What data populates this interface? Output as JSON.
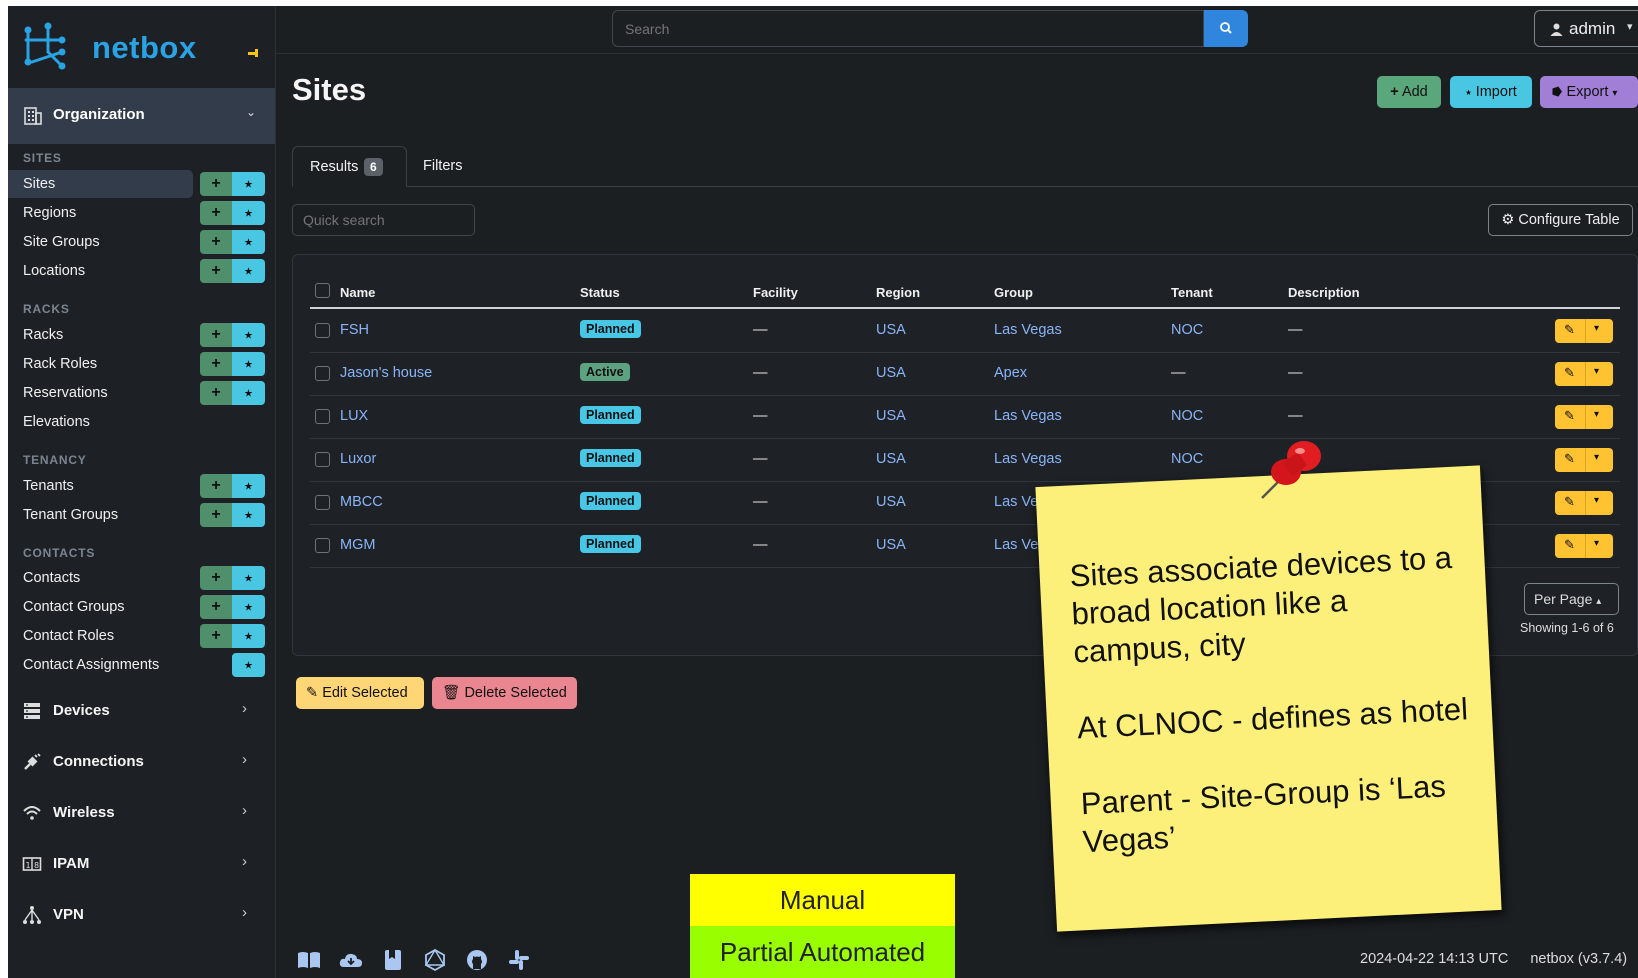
{
  "brand": {
    "name": "netbox"
  },
  "sidebar": {
    "org_label": "Organization",
    "sections": [
      {
        "title": "SITES",
        "items": [
          "Sites",
          "Regions",
          "Site Groups",
          "Locations"
        ]
      },
      {
        "title": "RACKS",
        "items": [
          "Racks",
          "Rack Roles",
          "Reservations",
          "Elevations"
        ]
      },
      {
        "title": "TENANCY",
        "items": [
          "Tenants",
          "Tenant Groups"
        ]
      },
      {
        "title": "CONTACTS",
        "items": [
          "Contacts",
          "Contact Groups",
          "Contact Roles",
          "Contact Assignments"
        ]
      }
    ],
    "groups": [
      "Devices",
      "Connections",
      "Wireless",
      "IPAM",
      "VPN"
    ]
  },
  "topbar": {
    "search_placeholder": "Search",
    "user": "admin"
  },
  "page": {
    "title": "Sites",
    "actions": {
      "add": "Add",
      "import": "Import",
      "export": "Export"
    },
    "tabs": {
      "results": "Results",
      "results_count": "6",
      "filters": "Filters"
    },
    "quick_search_placeholder": "Quick search",
    "configure": "Configure Table"
  },
  "table": {
    "columns": [
      "Name",
      "Status",
      "Facility",
      "Region",
      "Group",
      "Tenant",
      "Description"
    ],
    "rows": [
      {
        "name": "FSH",
        "status": "Planned",
        "facility": "—",
        "region": "USA",
        "group": "Las Vegas",
        "tenant": "NOC",
        "description": "—"
      },
      {
        "name": "Jason's house",
        "status": "Active",
        "facility": "—",
        "region": "USA",
        "group": "Apex",
        "tenant": "—",
        "description": "—"
      },
      {
        "name": "LUX",
        "status": "Planned",
        "facility": "—",
        "region": "USA",
        "group": "Las Vegas",
        "tenant": "NOC",
        "description": "—"
      },
      {
        "name": "Luxor",
        "status": "Planned",
        "facility": "—",
        "region": "USA",
        "group": "Las Vegas",
        "tenant": "NOC",
        "description": ""
      },
      {
        "name": "MBCC",
        "status": "Planned",
        "facility": "—",
        "region": "USA",
        "group": "Las Veg",
        "tenant": "",
        "description": ""
      },
      {
        "name": "MGM",
        "status": "Planned",
        "facility": "—",
        "region": "USA",
        "group": "Las Veg",
        "tenant": "",
        "description": ""
      }
    ],
    "per_page": "Per Page",
    "showing": "Showing 1-6 of 6"
  },
  "bulk": {
    "edit": "Edit Selected",
    "delete": "Delete Selected"
  },
  "footer": {
    "timestamp": "2024-04-22 14:13 UTC",
    "version": "netbox (v3.7.4)"
  },
  "sticky_note": {
    "text": "Sites associate devices to a broad location like a campus, city\n\nAt CLNOC - defines as hotel\n\nParent - Site-Group is ‘Las Vegas’"
  },
  "legend": {
    "manual": "Manual",
    "partial": "Partial Automated"
  },
  "colors": {
    "brand": "#2aa3e5",
    "add": "#4f8f6c",
    "import": "#49c6e2",
    "export": "#a27fd6",
    "planned": "#48c6e5",
    "active": "#5da37f",
    "edit": "#ffc331",
    "delete": "#ea868f"
  }
}
